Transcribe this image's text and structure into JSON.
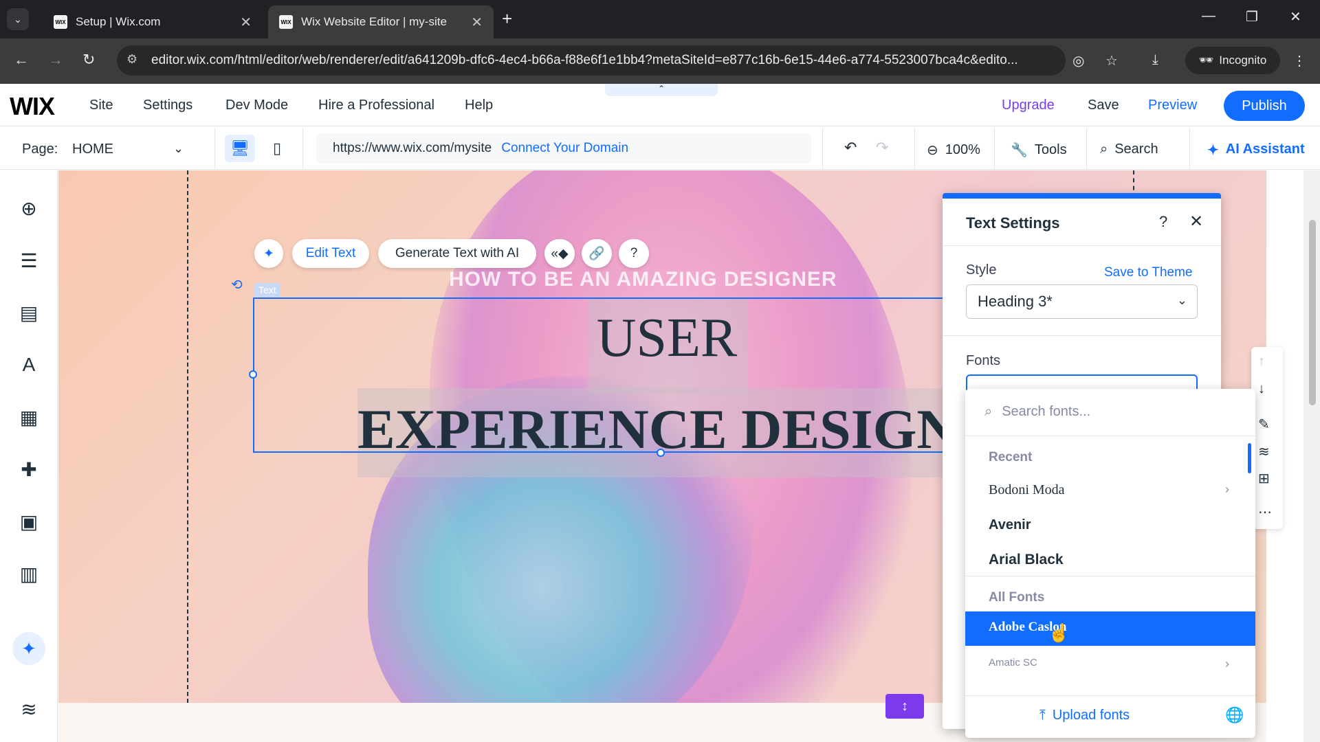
{
  "browser": {
    "tabs": [
      {
        "title": "Setup | Wix.com",
        "favicon": "WIX"
      },
      {
        "title": "Wix Website Editor | my-site",
        "favicon": "WIX"
      }
    ],
    "url": "editor.wix.com/html/editor/web/renderer/edit/a641209b-dfc6-4ec4-b66a-f88e6f1e1bb4?metaSiteId=e877c16b-6e15-44e6-a774-5523007bca4c&edito...",
    "incognito_label": "Incognito"
  },
  "wix_topbar": {
    "logo": "WIX",
    "menu": [
      "Site",
      "Settings",
      "Dev Mode",
      "Hire a Professional",
      "Help"
    ],
    "upgrade": "Upgrade",
    "save": "Save",
    "preview": "Preview",
    "publish": "Publish"
  },
  "toolbar": {
    "page_label": "Page:",
    "page_value": "HOME",
    "site_url": "https://www.wix.com/mysite",
    "connect_domain": "Connect Your Domain",
    "zoom": "100%",
    "tools": "Tools",
    "search": "Search",
    "ai_assistant": "AI Assistant"
  },
  "canvas": {
    "float_edit_text": "Edit Text",
    "float_generate": "Generate Text with AI",
    "text_label": "Text",
    "subtitle": "HOW TO BE AN AMAZING DESIGNER",
    "heading_line1": "USER",
    "heading_line2": "EXPERIENCE DESIGN"
  },
  "text_settings": {
    "title": "Text Settings",
    "help": "?",
    "style_label": "Style",
    "save_to_theme": "Save to Theme",
    "style_value": "Heading 3*",
    "fonts_label": "Fonts"
  },
  "font_dropdown": {
    "search_placeholder": "Search fonts...",
    "recent_label": "Recent",
    "recent": [
      "Bodoni Moda",
      "Avenir",
      "Arial Black"
    ],
    "all_label": "All Fonts",
    "selected": "Adobe Caslon",
    "next": "Amatic SC",
    "upload": "Upload fonts"
  },
  "colors": {
    "accent": "#116dff",
    "upgrade": "#7b3bed"
  }
}
